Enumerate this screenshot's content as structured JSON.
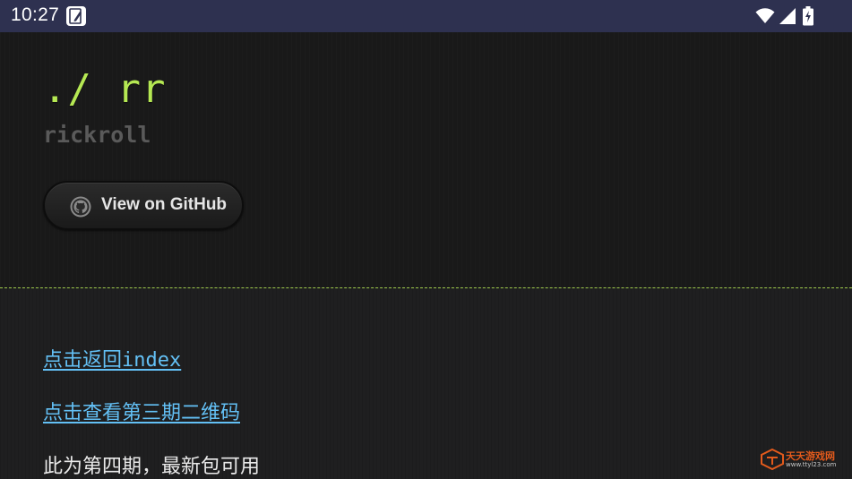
{
  "status_bar": {
    "time": "10:27",
    "app_icon": "edit-note-icon",
    "wifi_icon": "wifi-icon",
    "signal_icon": "cell-signal-icon",
    "battery_icon": "battery-charging-icon",
    "background": "#2e3150"
  },
  "header": {
    "title": "./ rr",
    "subtitle": "rickroll",
    "github_button_label": "View on GitHub",
    "github_icon": "github-icon",
    "title_color": "#b5e853"
  },
  "main": {
    "links": [
      {
        "label": "点击返回index"
      },
      {
        "label": "点击查看第三期二维码"
      }
    ],
    "notice": "此为第四期，最新包可用",
    "link_color": "#63c0f5"
  },
  "watermark": {
    "name": "天天游戏网",
    "url": "www.ttyl23.com"
  }
}
